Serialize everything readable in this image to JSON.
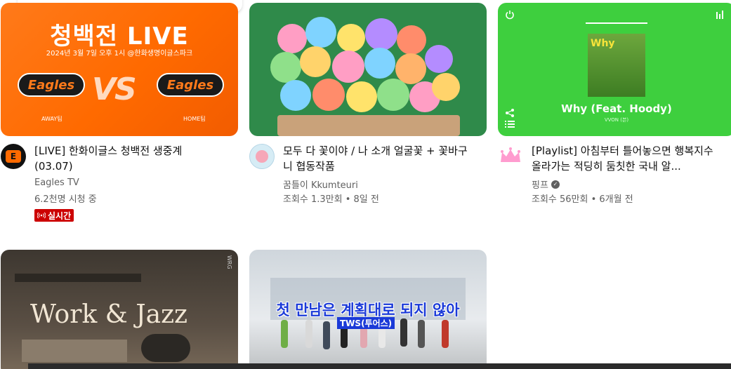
{
  "videos": [
    {
      "title": "[LIVE] 한화이글스 청백전 생중계 (03.07)",
      "channel": "Eagles TV",
      "meta": "6.2천명 시청 중",
      "badge": "실시간",
      "thumb": {
        "heading": "청백전 LIVE",
        "sub": "2024년 3월 7일 오후 1시 @한화생명이글스파크",
        "vs": "VS",
        "logo": "Eagles",
        "left_label": "AWAY팀",
        "right_label": "HOME팀"
      }
    },
    {
      "title": "모두 다 꽃이야 / 나 소개 얼굴꽃 + 꽃바구니 협동작품",
      "channel": "꿈틀이 Kkumteuri",
      "meta": "조회수 1.3만회 • 8일 전"
    },
    {
      "title": "[Playlist] 아침부터 틀어놓으면 행복지수 올라가는 적딩히 둠칫한 국내 알...",
      "channel": "핑프",
      "meta": "조회수 56만회 • 6개월 전",
      "thumb": {
        "album_title": "Why",
        "song": "Why (Feat. Hoody)",
        "artist": "VVON (븐)"
      }
    },
    {
      "thumb": {
        "text": "Work & Jazz",
        "corner": "WRG"
      }
    },
    {
      "thumb": {
        "line1": "첫 만남은 계획대로 되지 않아",
        "line2": "TWS(투어스)"
      }
    }
  ],
  "colors": {
    "live_red": "#cc0000",
    "orange": "#ff6a00",
    "green": "#3ecf3e"
  },
  "icons": {
    "live": "broadcast-icon",
    "verified": "check-circle-icon",
    "share": "share-icon",
    "list": "list-icon",
    "power": "power-icon"
  }
}
